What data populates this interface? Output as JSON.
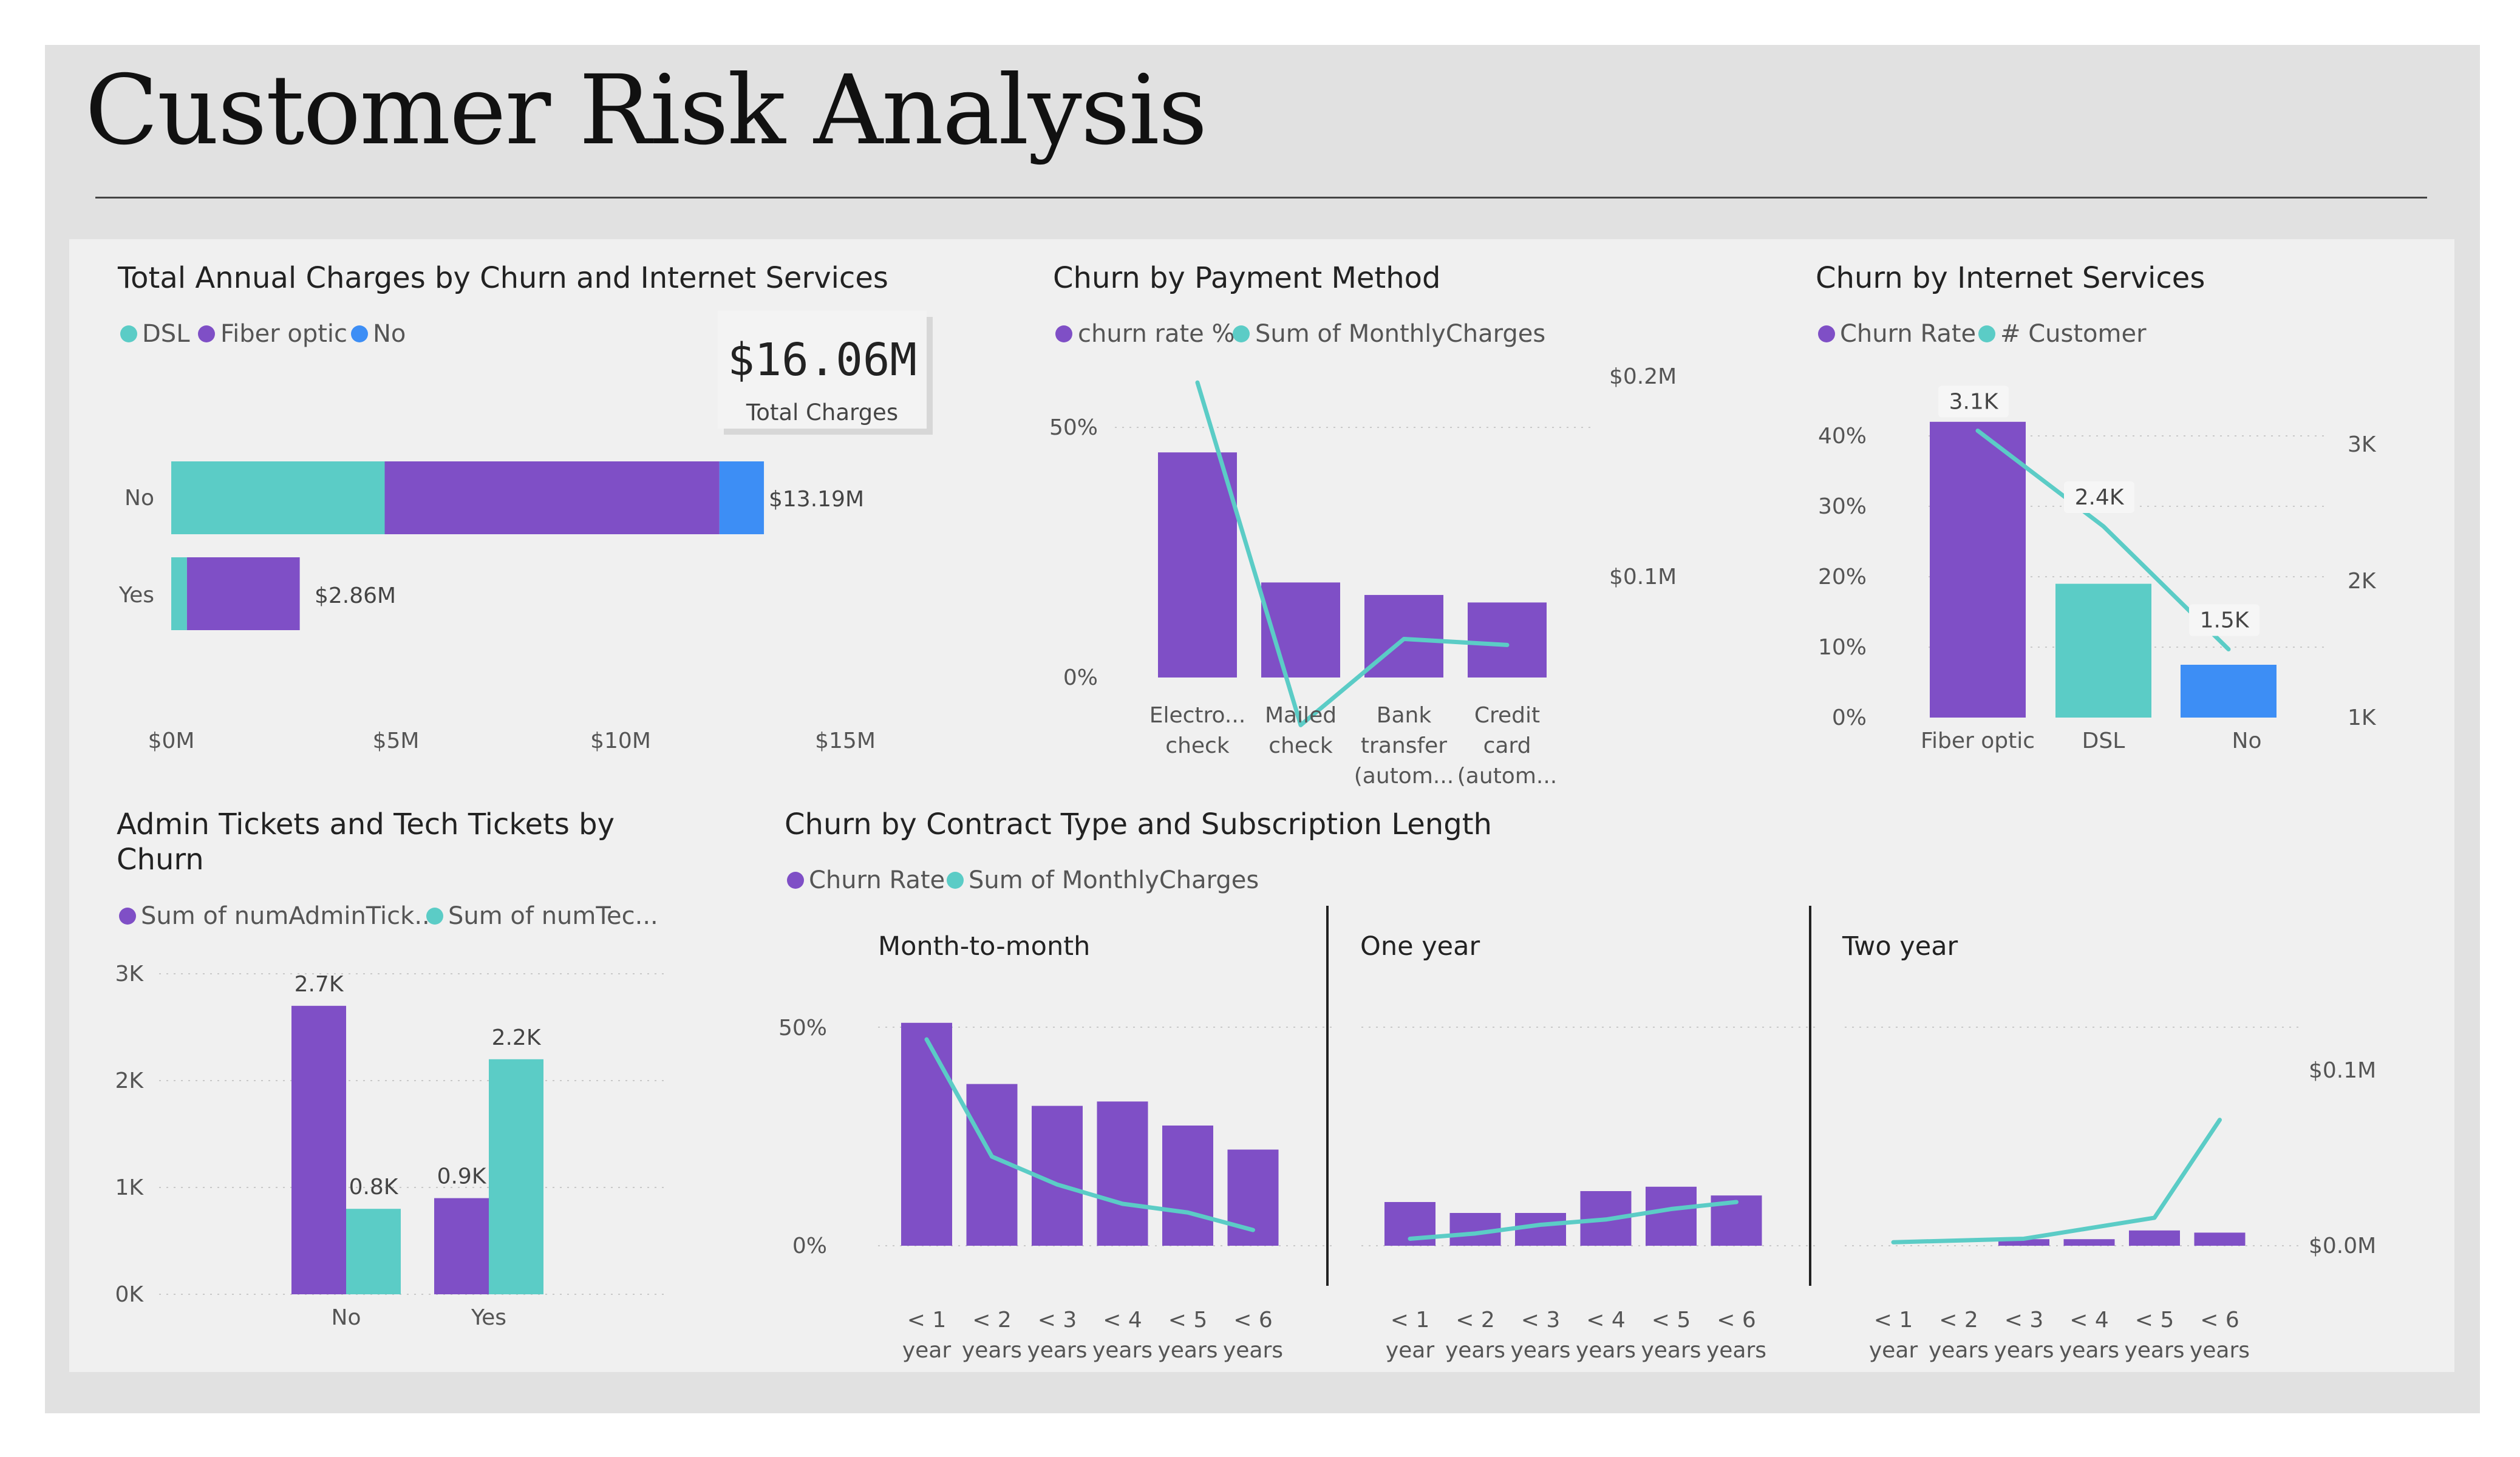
{
  "title": "Customer Risk Analysis",
  "colors": {
    "purple": "#7F4FC6",
    "teal": "#5BCCC6",
    "blue": "#3D8EF5",
    "frame": "#e1e1e1",
    "panel": "#f0f0f0"
  },
  "kpi": {
    "value": "$16.06M",
    "label": "Total Charges"
  },
  "chart_data": [
    {
      "id": "annual-charges",
      "type": "bar",
      "orientation": "horizontal",
      "stacked": true,
      "title": "Total Annual Charges by Churn and Internet Services",
      "legend": [
        "DSL",
        "Fiber optic",
        "No"
      ],
      "categories": [
        "No",
        "Yes"
      ],
      "series": [
        {
          "name": "DSL",
          "values": [
            4.75,
            0.35
          ]
        },
        {
          "name": "Fiber optic",
          "values": [
            7.45,
            2.51
          ]
        },
        {
          "name": "No",
          "values": [
            0.99,
            0
          ]
        }
      ],
      "totals": [
        "$13.19M",
        "$2.86M"
      ],
      "xticks": [
        "$0M",
        "$5M",
        "$10M",
        "$15M"
      ],
      "xlim": [
        0,
        15
      ]
    },
    {
      "id": "payment-method",
      "type": "bar",
      "title": "Churn by Payment Method",
      "legend": [
        "churn rate %",
        "Sum of MonthlyCharges"
      ],
      "categories": [
        [
          "Electro...",
          "check"
        ],
        [
          "Mailed",
          "check"
        ],
        [
          "Bank",
          "transfer",
          "(autom..."
        ],
        [
          "Credit",
          "card",
          "(autom..."
        ]
      ],
      "series": [
        {
          "name": "churn rate %",
          "values": [
            45,
            19,
            16.5,
            15
          ]
        },
        {
          "name": "Sum of MonthlyCharges",
          "values": [
            0.223,
            0.052,
            0.095,
            0.092
          ]
        }
      ],
      "yticks": [
        "0%",
        "50%"
      ],
      "y2ticks": [
        "$0.1M",
        "$0.2M"
      ]
    },
    {
      "id": "internet-services",
      "type": "bar",
      "title": "Churn by Internet Services",
      "legend": [
        "Churn Rate",
        "# Customer"
      ],
      "categories": [
        "Fiber optic",
        "DSL",
        "No"
      ],
      "series": [
        {
          "name": "Churn Rate",
          "values": [
            42,
            19,
            7.5
          ]
        },
        {
          "name": "# Customer",
          "values": [
            3.1,
            2.4,
            1.5
          ]
        }
      ],
      "labels": [
        "3.1K",
        "2.4K",
        "1.5K"
      ],
      "yticks": [
        "0%",
        "10%",
        "20%",
        "30%",
        "40%"
      ],
      "y2ticks": [
        "1K",
        "2K",
        "3K"
      ]
    },
    {
      "id": "tickets",
      "type": "bar",
      "title": [
        "Admin Tickets and Tech Tickets by",
        "Churn"
      ],
      "legend": [
        "Sum of numAdminTick...",
        "Sum of numTec..."
      ],
      "categories": [
        "No",
        "Yes"
      ],
      "series": [
        {
          "name": "Sum of numAdminTick...",
          "values": [
            2.7,
            0.9
          ]
        },
        {
          "name": "Sum of numTec...",
          "values": [
            0.8,
            2.2
          ]
        }
      ],
      "labels": [
        [
          "2.7K",
          "0.9K"
        ],
        [
          "0.8K",
          "2.2K"
        ]
      ],
      "yticks": [
        "0K",
        "1K",
        "2K",
        "3K"
      ]
    },
    {
      "id": "contract",
      "type": "bar",
      "title": "Churn by Contract Type and Subscription Length",
      "legend": [
        "Churn Rate",
        "Sum of MonthlyCharges"
      ],
      "yticks": [
        "0%",
        "50%"
      ],
      "y2ticks": [
        "$0.0M",
        "$0.1M"
      ],
      "xcategories": [
        [
          "< 1",
          "year"
        ],
        [
          "< 2",
          "years"
        ],
        [
          "< 3",
          "years"
        ],
        [
          "< 4",
          "years"
        ],
        [
          "< 5",
          "years"
        ],
        [
          "< 6",
          "years"
        ]
      ],
      "panels": [
        {
          "name": "Month-to-month",
          "churn": [
            51,
            37,
            32,
            33,
            27.5,
            22
          ],
          "charges": [
            0.118,
            0.051,
            0.035,
            0.024,
            0.019,
            0.009
          ]
        },
        {
          "name": "One year",
          "churn": [
            10,
            7.5,
            7.5,
            12.5,
            13.5,
            11.5
          ],
          "charges": [
            0.004,
            0.007,
            0.012,
            0.015,
            0.021,
            0.025
          ]
        },
        {
          "name": "Two year",
          "churn": [
            0,
            0,
            1.5,
            1.5,
            3.5,
            3
          ],
          "charges": [
            0.002,
            0.003,
            0.004,
            0.01,
            0.016,
            0.072
          ]
        }
      ]
    }
  ]
}
